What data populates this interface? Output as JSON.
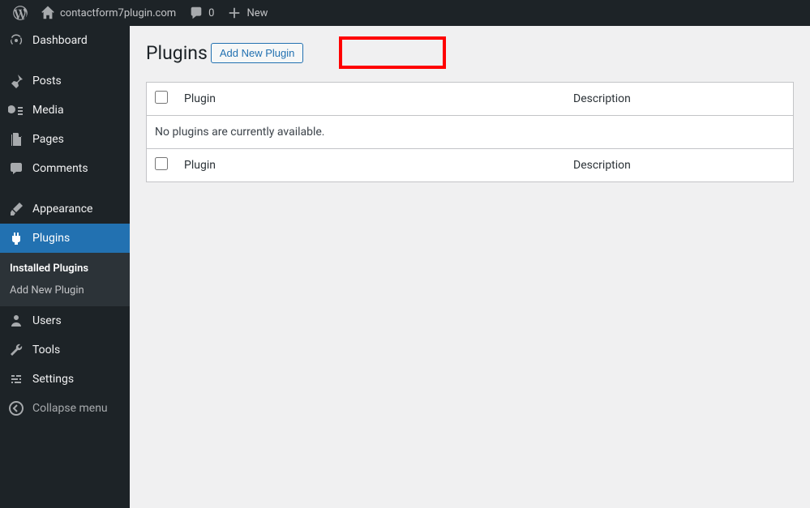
{
  "adminbar": {
    "site_name": "contactform7plugin.com",
    "comments_count": "0",
    "new_label": "New"
  },
  "sidebar": {
    "items": [
      {
        "label": "Dashboard"
      },
      {
        "label": "Posts"
      },
      {
        "label": "Media"
      },
      {
        "label": "Pages"
      },
      {
        "label": "Comments"
      },
      {
        "label": "Appearance"
      },
      {
        "label": "Plugins"
      },
      {
        "label": "Users"
      },
      {
        "label": "Tools"
      },
      {
        "label": "Settings"
      },
      {
        "label": "Collapse menu"
      }
    ],
    "plugins_submenu": {
      "installed": "Installed Plugins",
      "add_new": "Add New Plugin"
    }
  },
  "page": {
    "title": "Plugins",
    "add_new_label": "Add New Plugin"
  },
  "table": {
    "col_plugin": "Plugin",
    "col_description": "Description",
    "empty_message": "No plugins are currently available."
  }
}
